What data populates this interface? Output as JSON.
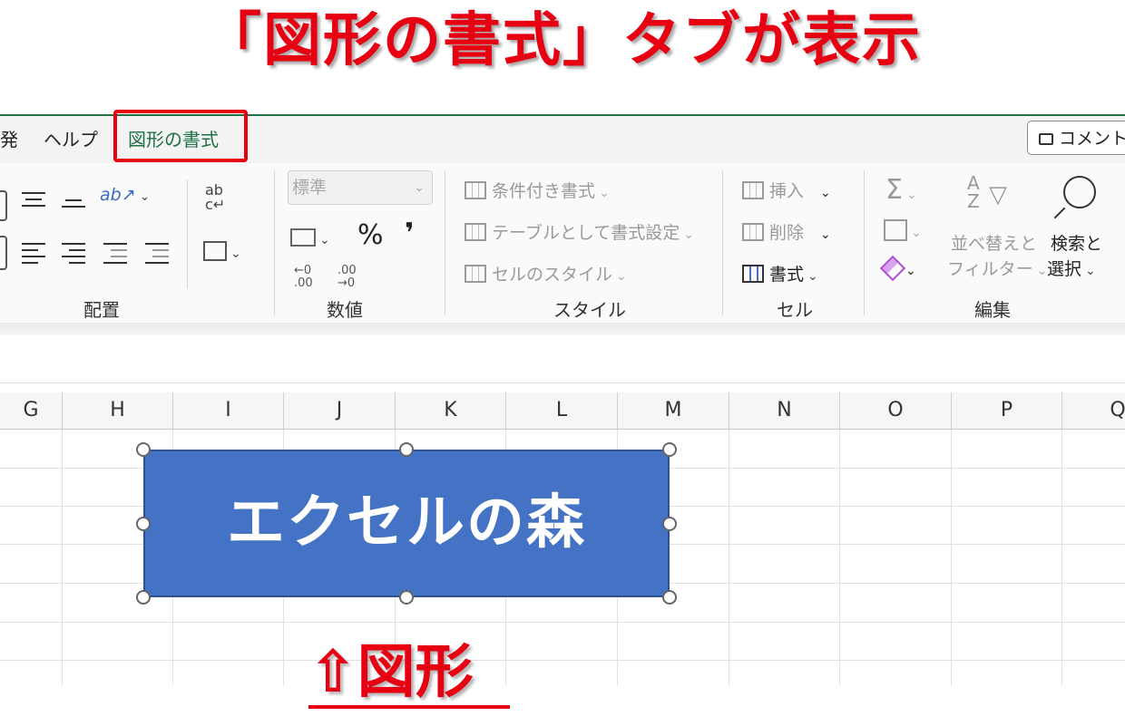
{
  "headline": "「図形の書式」タブが表示",
  "ribbon": {
    "tabs": [
      "発",
      "ヘルプ",
      "図形の書式"
    ],
    "comment_button": "コメント",
    "groups": {
      "alignment": "配置",
      "number": "数値",
      "style": "スタイル",
      "cells": "セル",
      "editing": "編集"
    },
    "number_format_value": "標準",
    "percent_symbol": "%",
    "comma_symbol": "❜",
    "style_tools": [
      "条件付き書式",
      "テーブルとして書式設定",
      "セルのスタイル"
    ],
    "cell_tools": [
      "挿入",
      "削除",
      "書式"
    ],
    "editing": {
      "sum_symbol": "Σ",
      "sort_filter": [
        "並べ替えと",
        "フィルター"
      ],
      "find_select": [
        "検索と",
        "選択"
      ]
    }
  },
  "sheet": {
    "columns": [
      "G",
      "H",
      "I",
      "J",
      "K",
      "L",
      "M",
      "N",
      "O",
      "P",
      "Q"
    ],
    "shape_text": "エクセルの森"
  },
  "callout": "⇧図形",
  "colors": {
    "accent_red": "#e60012",
    "excel_green": "#1e7145",
    "shape_blue": "#4472c4"
  }
}
